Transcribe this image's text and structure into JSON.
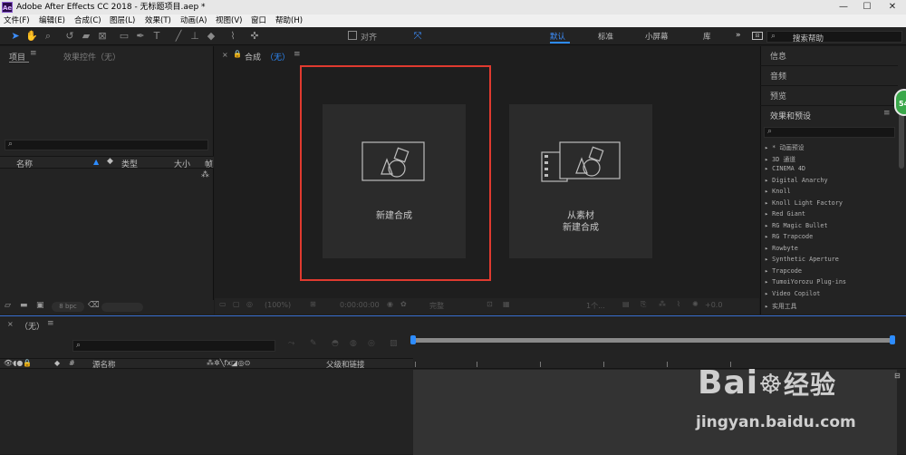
{
  "title": {
    "app_icon": "Ae",
    "text": "Adobe After Effects CC 2018 - 无标题项目.aep *",
    "min": "—",
    "max": "☐",
    "close": "✕"
  },
  "menu": [
    "文件(F)",
    "编辑(E)",
    "合成(C)",
    "图层(L)",
    "效果(T)",
    "动画(A)",
    "视图(V)",
    "窗口",
    "帮助(H)"
  ],
  "toolbar": {
    "snap_label": "对齐",
    "workspaces": [
      "默认",
      "标准",
      "小屏幕",
      "库"
    ],
    "more": "»",
    "search_placeholder": "搜索帮助"
  },
  "project": {
    "tab": "项目",
    "effects_tab": "效果控件（无）",
    "cols": {
      "name": "名称",
      "type": "类型",
      "size": "大小",
      "extra": "帧"
    },
    "bpc": "8 bpc"
  },
  "comp": {
    "tab": "合成",
    "tab_state": "（无）",
    "cards": [
      {
        "line1": "新建合成",
        "line2": ""
      },
      {
        "line1": "从素材",
        "line2": "新建合成"
      }
    ],
    "footer": {
      "zoom": "(100%)",
      "time": "0:00:00:00",
      "quality": "完整",
      "views": "1个...",
      "exposure": "+0.0"
    }
  },
  "right": {
    "items": [
      "信息",
      "音频",
      "预览"
    ],
    "effects_title": "效果和预设",
    "effects": [
      "▸ * 动画预设",
      "▸ 3D 通道",
      "▸ CINEMA 4D",
      "▸ Digital Anarchy",
      "▸ Knoll",
      "▸ Knoll Light Factory",
      "▸ Red Giant",
      "▸ RG Magic Bullet",
      "▸ RG Trapcode",
      "▸ Rowbyte",
      "▸ Synthetic Aperture",
      "▸ Trapcode",
      "▸ TumoiYorozu Plug-ins",
      "▸ Video Copilot",
      "▸ 实用工具"
    ],
    "badge": "54"
  },
  "timeline": {
    "tab": "（无）",
    "cols": {
      "source": "源名称",
      "parent": "父级和链接"
    }
  },
  "watermark": {
    "brand": "Bai",
    "brand2": "经验",
    "url": "jingyan.baidu.com"
  },
  "colors": {
    "accent": "#2d8cff",
    "highlight": "#e03a2f",
    "badge": "#3aa84a"
  }
}
